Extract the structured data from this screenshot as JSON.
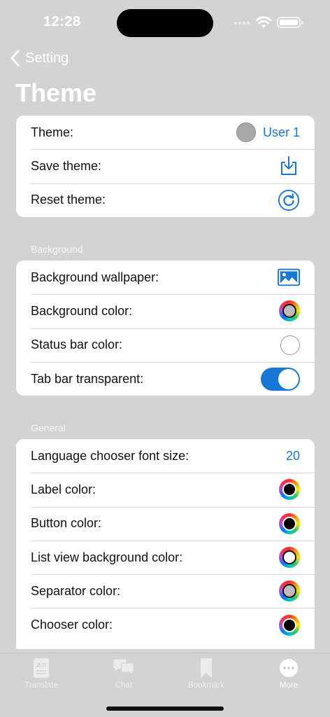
{
  "status_bar": {
    "time": "12:28"
  },
  "nav": {
    "back_label": "Setting",
    "title": "Theme"
  },
  "theme_section": {
    "rows": [
      {
        "label": "Theme:",
        "value": "User 1"
      },
      {
        "label": "Save theme:"
      },
      {
        "label": "Reset theme:"
      }
    ]
  },
  "background_section": {
    "header": "Background",
    "rows": [
      {
        "label": "Background wallpaper:"
      },
      {
        "label": "Background color:"
      },
      {
        "label": "Status bar color:"
      },
      {
        "label": "Tab bar transparent:",
        "toggle_on": true
      }
    ]
  },
  "general_section": {
    "header": "General",
    "rows": [
      {
        "label": "Language chooser font size:",
        "value": "20"
      },
      {
        "label": "Label color:"
      },
      {
        "label": "Button color:"
      },
      {
        "label": "List view background color:"
      },
      {
        "label": "Separator color:"
      },
      {
        "label": "Chooser color:"
      }
    ]
  },
  "tab_bar": {
    "tabs": [
      {
        "label": "Translate",
        "icon": "translate-icon"
      },
      {
        "label": "Chat",
        "icon": "chat-icon"
      },
      {
        "label": "Bookmark",
        "icon": "bookmark-icon"
      },
      {
        "label": "More",
        "icon": "more-icon",
        "active": true
      }
    ]
  },
  "colors": {
    "accent": "#1677d6",
    "background": "#d3d3d3",
    "card": "#ffffff"
  }
}
